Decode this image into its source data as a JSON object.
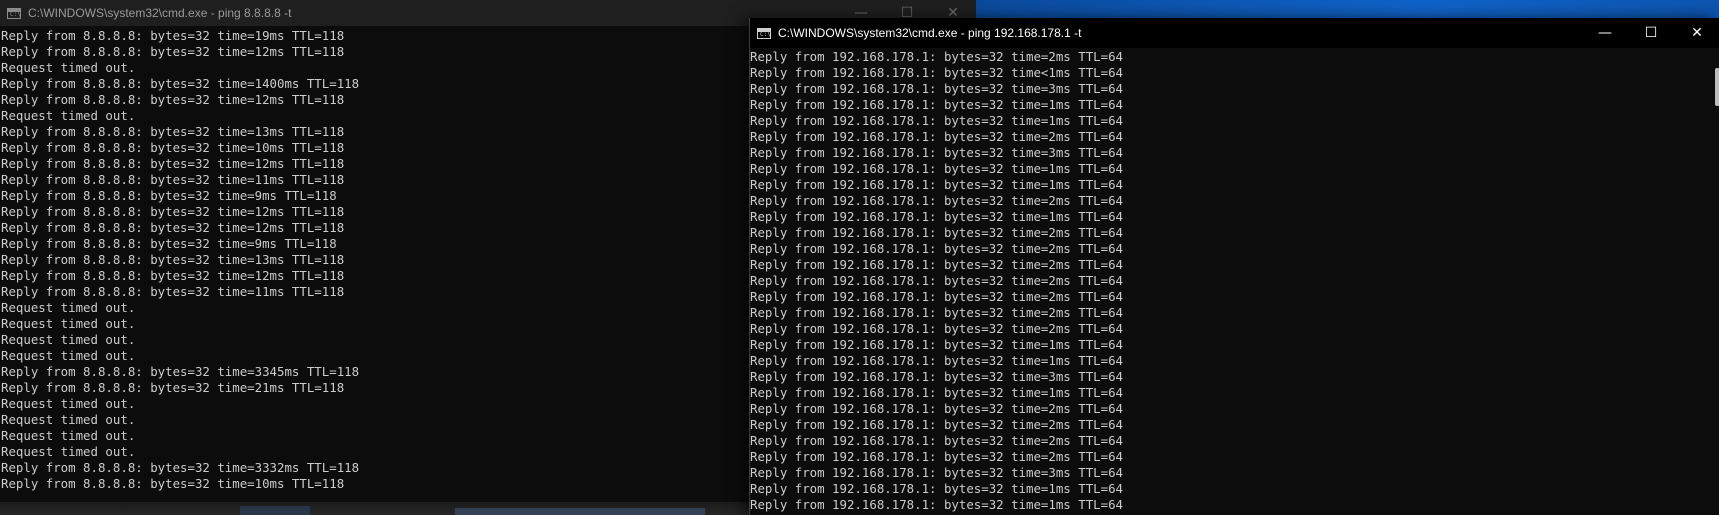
{
  "left_window": {
    "title": "C:\\WINDOWS\\system32\\cmd.exe - ping  8.8.8.8 -t",
    "icon_glyph": "C:\\",
    "controls": {
      "minimize": "—",
      "maximize": "☐",
      "close": "✕"
    },
    "lines": [
      "Reply from 8.8.8.8: bytes=32 time=19ms TTL=118",
      "Reply from 8.8.8.8: bytes=32 time=12ms TTL=118",
      "Request timed out.",
      "Reply from 8.8.8.8: bytes=32 time=1400ms TTL=118",
      "Reply from 8.8.8.8: bytes=32 time=12ms TTL=118",
      "Request timed out.",
      "Reply from 8.8.8.8: bytes=32 time=13ms TTL=118",
      "Reply from 8.8.8.8: bytes=32 time=10ms TTL=118",
      "Reply from 8.8.8.8: bytes=32 time=12ms TTL=118",
      "Reply from 8.8.8.8: bytes=32 time=11ms TTL=118",
      "Reply from 8.8.8.8: bytes=32 time=9ms TTL=118",
      "Reply from 8.8.8.8: bytes=32 time=12ms TTL=118",
      "Reply from 8.8.8.8: bytes=32 time=12ms TTL=118",
      "Reply from 8.8.8.8: bytes=32 time=9ms TTL=118",
      "Reply from 8.8.8.8: bytes=32 time=13ms TTL=118",
      "Reply from 8.8.8.8: bytes=32 time=12ms TTL=118",
      "Reply from 8.8.8.8: bytes=32 time=11ms TTL=118",
      "Request timed out.",
      "Request timed out.",
      "Request timed out.",
      "Request timed out.",
      "Reply from 8.8.8.8: bytes=32 time=3345ms TTL=118",
      "Reply from 8.8.8.8: bytes=32 time=21ms TTL=118",
      "Request timed out.",
      "Request timed out.",
      "Request timed out.",
      "Request timed out.",
      "Reply from 8.8.8.8: bytes=32 time=3332ms TTL=118",
      "Reply from 8.8.8.8: bytes=32 time=10ms TTL=118"
    ]
  },
  "right_window": {
    "title": "C:\\WINDOWS\\system32\\cmd.exe - ping  192.168.178.1 -t",
    "icon_glyph": "C:\\",
    "controls": {
      "minimize": "—",
      "maximize": "☐",
      "close": "✕"
    },
    "lines": [
      "Reply from 192.168.178.1: bytes=32 time=2ms TTL=64",
      "Reply from 192.168.178.1: bytes=32 time<1ms TTL=64",
      "Reply from 192.168.178.1: bytes=32 time=3ms TTL=64",
      "Reply from 192.168.178.1: bytes=32 time=1ms TTL=64",
      "Reply from 192.168.178.1: bytes=32 time=1ms TTL=64",
      "Reply from 192.168.178.1: bytes=32 time=2ms TTL=64",
      "Reply from 192.168.178.1: bytes=32 time=3ms TTL=64",
      "Reply from 192.168.178.1: bytes=32 time=1ms TTL=64",
      "Reply from 192.168.178.1: bytes=32 time=1ms TTL=64",
      "Reply from 192.168.178.1: bytes=32 time=2ms TTL=64",
      "Reply from 192.168.178.1: bytes=32 time=1ms TTL=64",
      "Reply from 192.168.178.1: bytes=32 time=2ms TTL=64",
      "Reply from 192.168.178.1: bytes=32 time=2ms TTL=64",
      "Reply from 192.168.178.1: bytes=32 time=2ms TTL=64",
      "Reply from 192.168.178.1: bytes=32 time=2ms TTL=64",
      "Reply from 192.168.178.1: bytes=32 time=2ms TTL=64",
      "Reply from 192.168.178.1: bytes=32 time=2ms TTL=64",
      "Reply from 192.168.178.1: bytes=32 time=2ms TTL=64",
      "Reply from 192.168.178.1: bytes=32 time=1ms TTL=64",
      "Reply from 192.168.178.1: bytes=32 time=1ms TTL=64",
      "Reply from 192.168.178.1: bytes=32 time=3ms TTL=64",
      "Reply from 192.168.178.1: bytes=32 time=1ms TTL=64",
      "Reply from 192.168.178.1: bytes=32 time=2ms TTL=64",
      "Reply from 192.168.178.1: bytes=32 time=2ms TTL=64",
      "Reply from 192.168.178.1: bytes=32 time=2ms TTL=64",
      "Reply from 192.168.178.1: bytes=32 time=2ms TTL=64",
      "Reply from 192.168.178.1: bytes=32 time=3ms TTL=64",
      "Reply from 192.168.178.1: bytes=32 time=1ms TTL=64",
      "Reply from 192.168.178.1: bytes=32 time=1ms TTL=64"
    ]
  },
  "colors": {
    "console_bg": "#0c0c0c",
    "console_text": "#cccccc",
    "active_titlebar": "#000000",
    "inactive_titlebar": "#1f1f1f",
    "desktop_accent": "#1063c9"
  }
}
